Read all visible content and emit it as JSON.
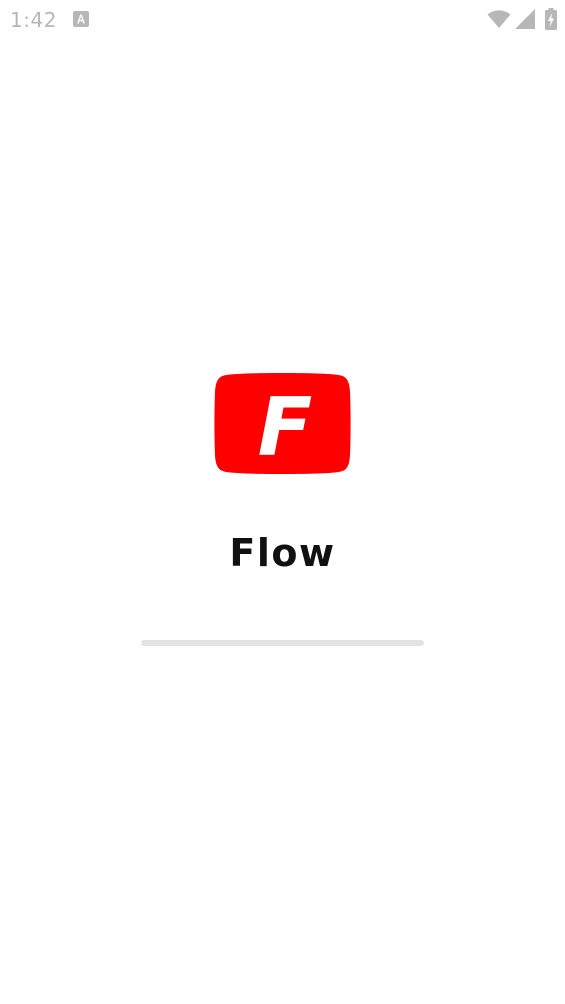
{
  "status_bar": {
    "time": "1:42",
    "notification_icon": "a-badge-icon",
    "icons": [
      "wifi-icon",
      "signal-icon",
      "battery-charging-icon"
    ]
  },
  "splash": {
    "logo_letter": "F",
    "app_name": "Flow",
    "progress": 0
  },
  "colors": {
    "brand_red": "#ff0000",
    "status_gray": "#b7b7b7",
    "text": "#111111",
    "progress_track": "#e3e3e3"
  }
}
